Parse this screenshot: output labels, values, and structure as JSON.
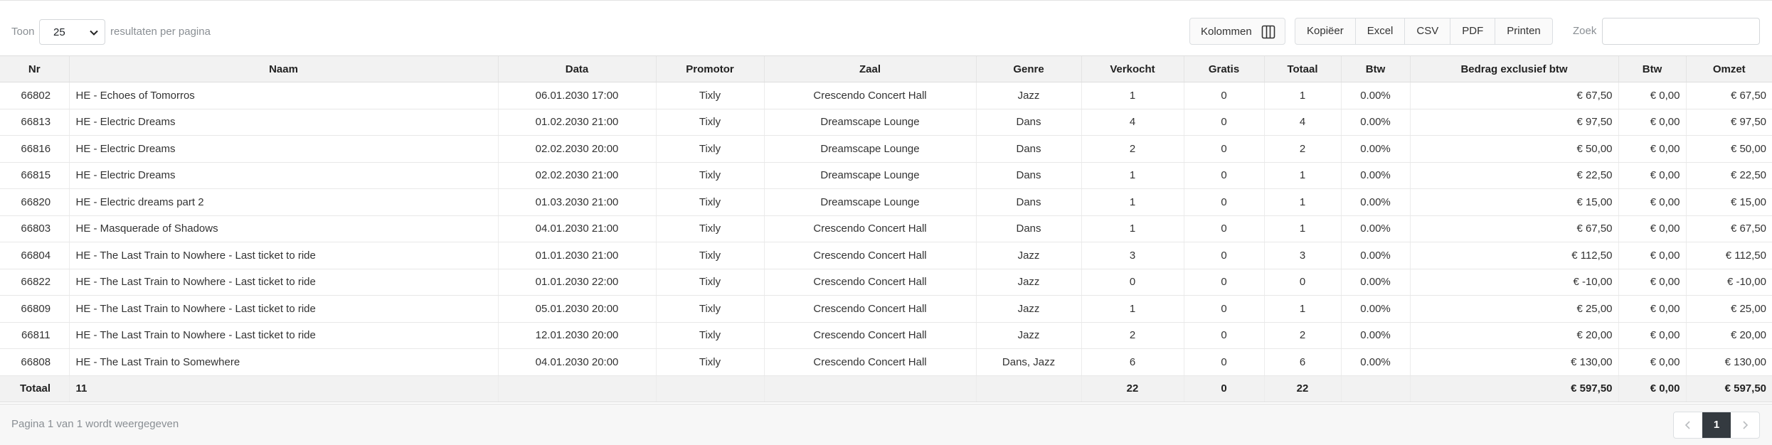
{
  "toolbar": {
    "show_label": "Toon",
    "page_length": "25",
    "per_page_label": "resultaten per pagina",
    "columns_label": "Kolommen",
    "export_buttons": [
      "Kopiëer",
      "Excel",
      "CSV",
      "PDF",
      "Printen"
    ],
    "search_label": "Zoek",
    "search_value": ""
  },
  "table": {
    "headers": [
      "Nr",
      "Naam",
      "Data",
      "Promotor",
      "Zaal",
      "Genre",
      "Verkocht",
      "Gratis",
      "Totaal",
      "Btw",
      "Bedrag exclusief btw",
      "Btw",
      "Omzet"
    ],
    "rows": [
      [
        "66802",
        "HE - Echoes of Tomorros",
        "06.01.2030 17:00",
        "Tixly",
        "Crescendo Concert Hall",
        "Jazz",
        "1",
        "0",
        "1",
        "0.00%",
        "€ 67,50",
        "€ 0,00",
        "€ 67,50"
      ],
      [
        "66813",
        "HE - Electric Dreams",
        "01.02.2030 21:00",
        "Tixly",
        "Dreamscape Lounge",
        "Dans",
        "4",
        "0",
        "4",
        "0.00%",
        "€ 97,50",
        "€ 0,00",
        "€ 97,50"
      ],
      [
        "66816",
        "HE - Electric Dreams",
        "02.02.2030 20:00",
        "Tixly",
        "Dreamscape Lounge",
        "Dans",
        "2",
        "0",
        "2",
        "0.00%",
        "€ 50,00",
        "€ 0,00",
        "€ 50,00"
      ],
      [
        "66815",
        "HE - Electric Dreams",
        "02.02.2030 21:00",
        "Tixly",
        "Dreamscape Lounge",
        "Dans",
        "1",
        "0",
        "1",
        "0.00%",
        "€ 22,50",
        "€ 0,00",
        "€ 22,50"
      ],
      [
        "66820",
        "HE - Electric dreams part 2",
        "01.03.2030 21:00",
        "Tixly",
        "Dreamscape Lounge",
        "Dans",
        "1",
        "0",
        "1",
        "0.00%",
        "€ 15,00",
        "€ 0,00",
        "€ 15,00"
      ],
      [
        "66803",
        "HE - Masquerade of Shadows",
        "04.01.2030 21:00",
        "Tixly",
        "Crescendo Concert Hall",
        "Dans",
        "1",
        "0",
        "1",
        "0.00%",
        "€ 67,50",
        "€ 0,00",
        "€ 67,50"
      ],
      [
        "66804",
        "HE - The Last Train to Nowhere - Last ticket to ride",
        "01.01.2030 21:00",
        "Tixly",
        "Crescendo Concert Hall",
        "Jazz",
        "3",
        "0",
        "3",
        "0.00%",
        "€ 112,50",
        "€ 0,00",
        "€ 112,50"
      ],
      [
        "66822",
        "HE - The Last Train to Nowhere - Last ticket to ride",
        "01.01.2030 22:00",
        "Tixly",
        "Crescendo Concert Hall",
        "Jazz",
        "0",
        "0",
        "0",
        "0.00%",
        "€ -10,00",
        "€ 0,00",
        "€ -10,00"
      ],
      [
        "66809",
        "HE - The Last Train to Nowhere - Last ticket to ride",
        "05.01.2030 20:00",
        "Tixly",
        "Crescendo Concert Hall",
        "Jazz",
        "1",
        "0",
        "1",
        "0.00%",
        "€ 25,00",
        "€ 0,00",
        "€ 25,00"
      ],
      [
        "66811",
        "HE - The Last Train to Nowhere - Last ticket to ride",
        "12.01.2030 20:00",
        "Tixly",
        "Crescendo Concert Hall",
        "Jazz",
        "2",
        "0",
        "2",
        "0.00%",
        "€ 20,00",
        "€ 0,00",
        "€ 20,00"
      ],
      [
        "66808",
        "HE - The Last Train to Somewhere",
        "04.01.2030 20:00",
        "Tixly",
        "Crescendo Concert Hall",
        "Dans, Jazz",
        "6",
        "0",
        "6",
        "0.00%",
        "€ 130,00",
        "€ 0,00",
        "€ 130,00"
      ]
    ],
    "totals": [
      "Totaal",
      "11",
      "",
      "",
      "",
      "",
      "22",
      "0",
      "22",
      "",
      "€ 597,50",
      "€ 0,00",
      "€ 597,50"
    ]
  },
  "footer": {
    "info": "Pagina 1 van 1 wordt weergegeven",
    "current_page": "1"
  },
  "icons": {
    "columns": "columns-icon",
    "select": "chevron-down-icon",
    "prev": "chevron-left-icon",
    "next": "chevron-right-icon"
  }
}
